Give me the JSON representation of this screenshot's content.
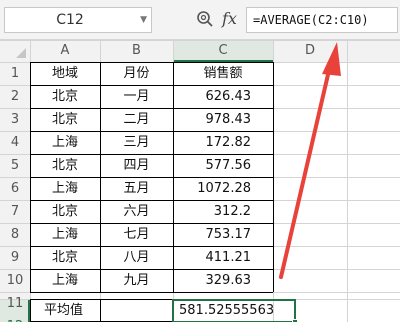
{
  "formula_bar": {
    "name_box": "C12",
    "fx_label": "fx",
    "formula": "=AVERAGE(C2:C10)"
  },
  "columns": [
    "A",
    "B",
    "C",
    "D"
  ],
  "rows": [
    "1",
    "2",
    "3",
    "4",
    "5",
    "6",
    "7",
    "8",
    "9",
    "10",
    "11",
    "12"
  ],
  "table": {
    "headers": [
      "地域",
      "月份",
      "销售额"
    ],
    "data": [
      [
        "北京",
        "一月",
        "626.43"
      ],
      [
        "北京",
        "二月",
        "978.43"
      ],
      [
        "上海",
        "三月",
        "172.82"
      ],
      [
        "北京",
        "四月",
        "577.56"
      ],
      [
        "上海",
        "五月",
        "1072.28"
      ],
      [
        "北京",
        "六月",
        "312.2"
      ],
      [
        "上海",
        "七月",
        "753.17"
      ],
      [
        "北京",
        "八月",
        "411.21"
      ],
      [
        "上海",
        "九月",
        "329.63"
      ]
    ]
  },
  "average_row": {
    "label": "平均值",
    "value": "581.52555563"
  },
  "colors": {
    "selection": "#217346",
    "arrow": "#e8423a",
    "header_bg": "#f2f2f2",
    "header_selected_bg": "#dfe9e2",
    "gridline": "#d4d4d4",
    "table_border": "#000000"
  }
}
